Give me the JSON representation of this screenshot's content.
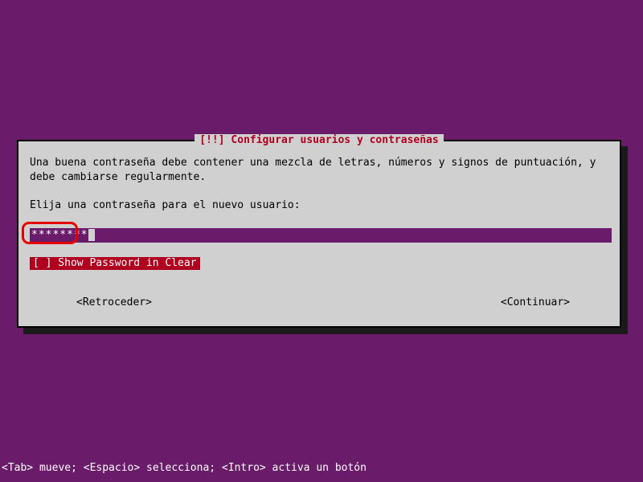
{
  "dialog": {
    "title_prefix": "[!!] ",
    "title": "Configurar usuarios y contraseñas",
    "body": "Una buena contraseña debe contener una mezcla de letras, números y signos de puntuación, y debe cambiarse regularmente.",
    "prompt": "Elija una contraseña para el nuevo usuario:",
    "password_value": "********",
    "show_password_checkbox": "[ ] Show Password in Clear",
    "nav_back": "<Retroceder>",
    "nav_forward": "<Continuar>"
  },
  "status_bar": "<Tab> mueve; <Espacio> selecciona; <Intro> activa un botón"
}
